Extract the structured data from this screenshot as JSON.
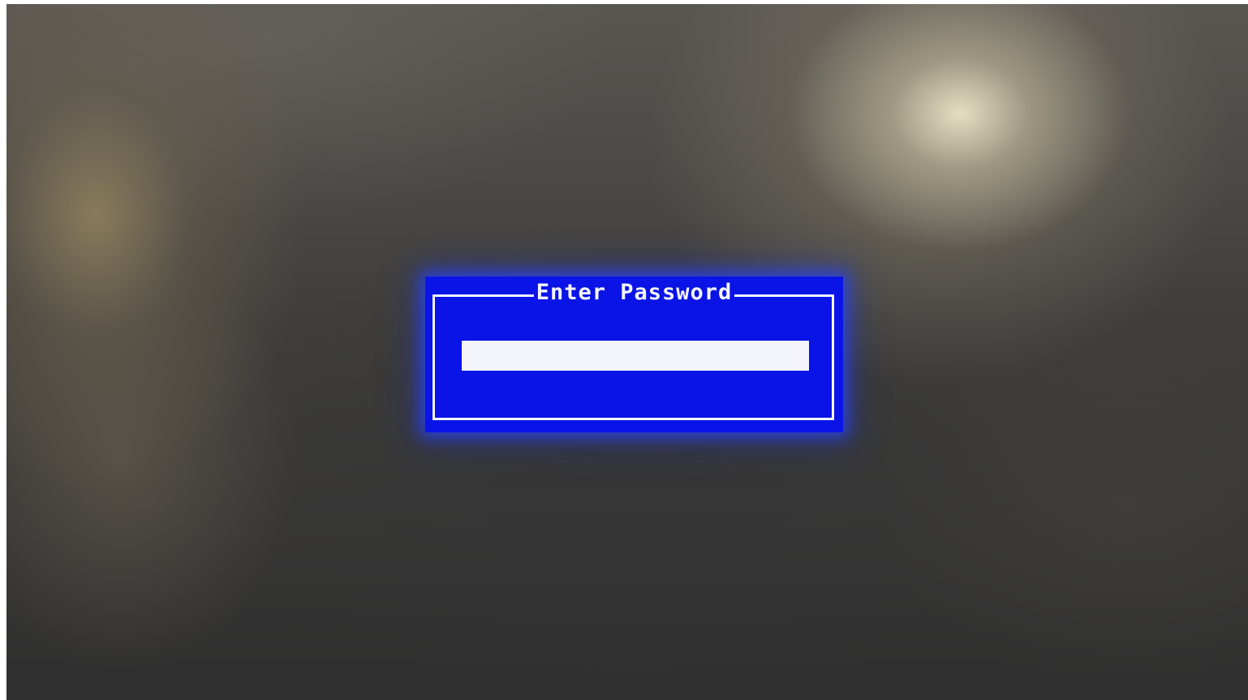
{
  "password_prompt": {
    "title": "Enter Password",
    "value": ""
  },
  "colors": {
    "dialog_background": "#0a14e6",
    "dialog_border": "#f2f4ff",
    "title_text": "#f4f6ff",
    "input_background": "#f4f5fb"
  }
}
